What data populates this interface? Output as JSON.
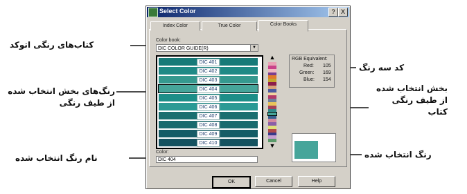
{
  "dialog": {
    "title": "Select Color",
    "help_glyph": "?",
    "close_glyph": "X",
    "tabs": [
      {
        "label": "Index Color"
      },
      {
        "label": "True Color"
      },
      {
        "label": "Color Books"
      }
    ],
    "color_book_label": "Color book:",
    "color_book_value": "DIC COLOR GUIDE(R)",
    "swatches": [
      {
        "label": "DIC 401",
        "color": "#177a78"
      },
      {
        "label": "DIC 402",
        "color": "#1f8a86"
      },
      {
        "label": "DIC 403",
        "color": "#35998f"
      },
      {
        "label": "DIC 404",
        "color": "#46a59a"
      },
      {
        "label": "DIC 405",
        "color": "#1d8e88"
      },
      {
        "label": "DIC 406",
        "color": "#2b9a95"
      },
      {
        "label": "DIC 407",
        "color": "#1a6f70"
      },
      {
        "label": "DIC 408",
        "color": "#186a6e"
      },
      {
        "label": "DIC 409",
        "color": "#155c66"
      },
      {
        "label": "DIC 410",
        "color": "#145260"
      }
    ],
    "selected_index": 3,
    "strip_colors": [
      "#e8a3b5",
      "#c9428a",
      "#f0b9c2",
      "#7a3f8f",
      "#e07a2a",
      "#c4a52f",
      "#8d1e4a",
      "#d7a27a",
      "#4a5aa0",
      "#f2d3a0",
      "#b23a6a",
      "#6f7f9a",
      "#e9c45b",
      "#a4415a",
      "#2f8a8a",
      "#46a59a",
      "#375f8f",
      "#d58aa0",
      "#8a5fa8",
      "#e0e07a",
      "#b24a4a",
      "#3a3a8a",
      "#c7a0d0",
      "#5a9a6a"
    ],
    "strip_marker_index": 15,
    "rgb": {
      "title": "RGB Equivalent:",
      "red_label": "Red:",
      "red_value": "105",
      "green_label": "Green:",
      "green_value": "169",
      "blue_label": "Blue:",
      "blue_value": "154"
    },
    "color_label": "Color:",
    "color_value": "DIC 404",
    "preview_color": "#46a59a",
    "buttons": {
      "ok": "OK",
      "cancel": "Cancel",
      "help": "Help"
    }
  },
  "annotations": {
    "books": "کتاب‌های رنگی اتوکد",
    "sel_colors": "رنگ‌های بخش انتخاب شده از طیف رنگی",
    "color_name": "نام رنگ انتخاب شده",
    "rgb_code": "کد سه رنگ",
    "spectrum_part": "بخش انتخاب شده از طیف رنگی کتاب",
    "selected_color": "رنگ انتخاب شده"
  }
}
